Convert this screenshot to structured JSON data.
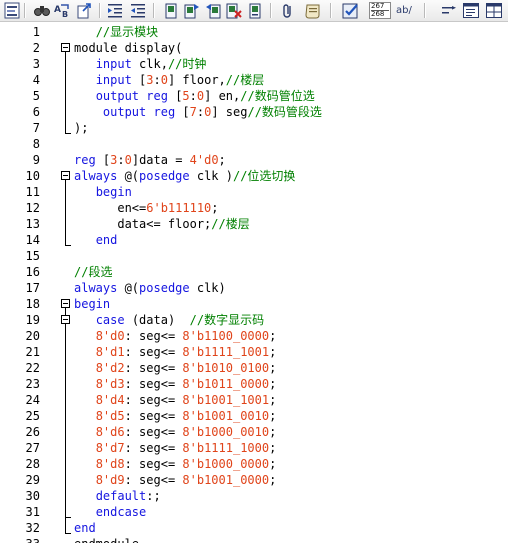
{
  "toolbar": {
    "buttons": [
      {
        "name": "editor-icon"
      },
      {
        "name": "find-icon"
      },
      {
        "name": "replace-icon"
      },
      {
        "name": "goto-icon"
      },
      {
        "name": "indent-icon"
      },
      {
        "name": "outdent-icon"
      },
      {
        "name": "bookmark-toggle-icon"
      },
      {
        "name": "bookmark-next-icon"
      },
      {
        "name": "bookmark-prev-icon"
      },
      {
        "name": "bookmark-clear-icon"
      },
      {
        "name": "bookmark-list-icon"
      },
      {
        "name": "attach-icon"
      },
      {
        "name": "macro-icon"
      },
      {
        "name": "check-icon"
      },
      {
        "name": "number-convert-icon"
      },
      {
        "name": "abbrev-icon"
      },
      {
        "name": "wrap-icon"
      },
      {
        "name": "document-icon"
      },
      {
        "name": "table-icon"
      }
    ],
    "number_icon_top": "267",
    "number_icon_bottom": "268",
    "abbrev_label": "ab/"
  },
  "editor": {
    "lines": [
      {
        "n": "1",
        "tokens": [
          {
            "t": "   ",
            "c": "pun"
          },
          {
            "t": "//显示模块",
            "c": "cmt"
          }
        ]
      },
      {
        "n": "2",
        "tokens": [
          {
            "t": "module display(",
            "c": "pun"
          }
        ]
      },
      {
        "n": "3",
        "tokens": [
          {
            "t": "   ",
            "c": "pun"
          },
          {
            "t": "input",
            "c": "kw"
          },
          {
            "t": " clk,",
            "c": "pun"
          },
          {
            "t": "//时钟",
            "c": "cmt"
          }
        ]
      },
      {
        "n": "4",
        "tokens": [
          {
            "t": "   ",
            "c": "pun"
          },
          {
            "t": "input",
            "c": "kw"
          },
          {
            "t": " [",
            "c": "pun"
          },
          {
            "t": "3",
            "c": "num"
          },
          {
            "t": ":",
            "c": "pun"
          },
          {
            "t": "0",
            "c": "num"
          },
          {
            "t": "] floor,",
            "c": "pun"
          },
          {
            "t": "//楼层",
            "c": "cmt"
          }
        ]
      },
      {
        "n": "5",
        "tokens": [
          {
            "t": "   ",
            "c": "pun"
          },
          {
            "t": "output",
            "c": "kw"
          },
          {
            "t": " ",
            "c": "pun"
          },
          {
            "t": "reg",
            "c": "kw"
          },
          {
            "t": " [",
            "c": "pun"
          },
          {
            "t": "5",
            "c": "num"
          },
          {
            "t": ":",
            "c": "pun"
          },
          {
            "t": "0",
            "c": "num"
          },
          {
            "t": "] en,",
            "c": "pun"
          },
          {
            "t": "//数码管位选",
            "c": "cmt"
          }
        ]
      },
      {
        "n": "6",
        "tokens": [
          {
            "t": "    ",
            "c": "pun"
          },
          {
            "t": "output",
            "c": "kw"
          },
          {
            "t": " ",
            "c": "pun"
          },
          {
            "t": "reg",
            "c": "kw"
          },
          {
            "t": " [",
            "c": "pun"
          },
          {
            "t": "7",
            "c": "num"
          },
          {
            "t": ":",
            "c": "pun"
          },
          {
            "t": "0",
            "c": "num"
          },
          {
            "t": "] seg",
            "c": "pun"
          },
          {
            "t": "//数码管段选",
            "c": "cmt"
          }
        ]
      },
      {
        "n": "7",
        "tokens": [
          {
            "t": ");",
            "c": "pun"
          }
        ]
      },
      {
        "n": "8",
        "tokens": []
      },
      {
        "n": "9",
        "tokens": [
          {
            "t": "reg",
            "c": "kw"
          },
          {
            "t": " [",
            "c": "pun"
          },
          {
            "t": "3",
            "c": "num"
          },
          {
            "t": ":",
            "c": "pun"
          },
          {
            "t": "0",
            "c": "num"
          },
          {
            "t": "]data = ",
            "c": "pun"
          },
          {
            "t": "4'd0",
            "c": "num"
          },
          {
            "t": ";",
            "c": "pun"
          }
        ]
      },
      {
        "n": "10",
        "tokens": [
          {
            "t": "always",
            "c": "kw"
          },
          {
            "t": " @(",
            "c": "pun"
          },
          {
            "t": "posedge",
            "c": "kw"
          },
          {
            "t": " clk )",
            "c": "pun"
          },
          {
            "t": "//位选切换",
            "c": "cmt"
          }
        ]
      },
      {
        "n": "11",
        "tokens": [
          {
            "t": "   ",
            "c": "pun"
          },
          {
            "t": "begin",
            "c": "kw"
          }
        ]
      },
      {
        "n": "12",
        "tokens": [
          {
            "t": "      en<=",
            "c": "pun"
          },
          {
            "t": "6'b111110",
            "c": "num"
          },
          {
            "t": ";",
            "c": "pun"
          }
        ]
      },
      {
        "n": "13",
        "tokens": [
          {
            "t": "      data<= floor;",
            "c": "pun"
          },
          {
            "t": "//楼层",
            "c": "cmt"
          }
        ]
      },
      {
        "n": "14",
        "tokens": [
          {
            "t": "   ",
            "c": "pun"
          },
          {
            "t": "end",
            "c": "kw"
          }
        ]
      },
      {
        "n": "15",
        "tokens": []
      },
      {
        "n": "16",
        "tokens": [
          {
            "t": "//段选",
            "c": "cmt"
          }
        ]
      },
      {
        "n": "17",
        "tokens": [
          {
            "t": "always",
            "c": "kw"
          },
          {
            "t": " @(",
            "c": "pun"
          },
          {
            "t": "posedge",
            "c": "kw"
          },
          {
            "t": " clk)",
            "c": "pun"
          }
        ]
      },
      {
        "n": "18",
        "tokens": [
          {
            "t": "begin",
            "c": "kw"
          }
        ]
      },
      {
        "n": "19",
        "tokens": [
          {
            "t": "   ",
            "c": "pun"
          },
          {
            "t": "case",
            "c": "kw"
          },
          {
            "t": " (data)  ",
            "c": "pun"
          },
          {
            "t": "//数字显示码",
            "c": "cmt"
          }
        ]
      },
      {
        "n": "20",
        "tokens": [
          {
            "t": "   ",
            "c": "pun"
          },
          {
            "t": "8'd0",
            "c": "num"
          },
          {
            "t": ": seg<= ",
            "c": "pun"
          },
          {
            "t": "8'b1100_0000",
            "c": "num"
          },
          {
            "t": ";",
            "c": "pun"
          }
        ]
      },
      {
        "n": "21",
        "tokens": [
          {
            "t": "   ",
            "c": "pun"
          },
          {
            "t": "8'd1",
            "c": "num"
          },
          {
            "t": ": seg<= ",
            "c": "pun"
          },
          {
            "t": "8'b1111_1001",
            "c": "num"
          },
          {
            "t": ";",
            "c": "pun"
          }
        ]
      },
      {
        "n": "22",
        "tokens": [
          {
            "t": "   ",
            "c": "pun"
          },
          {
            "t": "8'd2",
            "c": "num"
          },
          {
            "t": ": seg<= ",
            "c": "pun"
          },
          {
            "t": "8'b1010_0100",
            "c": "num"
          },
          {
            "t": ";",
            "c": "pun"
          }
        ]
      },
      {
        "n": "23",
        "tokens": [
          {
            "t": "   ",
            "c": "pun"
          },
          {
            "t": "8'd3",
            "c": "num"
          },
          {
            "t": ": seg<= ",
            "c": "pun"
          },
          {
            "t": "8'b1011_0000",
            "c": "num"
          },
          {
            "t": ";",
            "c": "pun"
          }
        ]
      },
      {
        "n": "24",
        "tokens": [
          {
            "t": "   ",
            "c": "pun"
          },
          {
            "t": "8'd4",
            "c": "num"
          },
          {
            "t": ": seg<= ",
            "c": "pun"
          },
          {
            "t": "8'b1001_1001",
            "c": "num"
          },
          {
            "t": ";",
            "c": "pun"
          }
        ]
      },
      {
        "n": "25",
        "tokens": [
          {
            "t": "   ",
            "c": "pun"
          },
          {
            "t": "8'd5",
            "c": "num"
          },
          {
            "t": ": seg<= ",
            "c": "pun"
          },
          {
            "t": "8'b1001_0010",
            "c": "num"
          },
          {
            "t": ";",
            "c": "pun"
          }
        ]
      },
      {
        "n": "26",
        "tokens": [
          {
            "t": "   ",
            "c": "pun"
          },
          {
            "t": "8'd6",
            "c": "num"
          },
          {
            "t": ": seg<= ",
            "c": "pun"
          },
          {
            "t": "8'b1000_0010",
            "c": "num"
          },
          {
            "t": ";",
            "c": "pun"
          }
        ]
      },
      {
        "n": "27",
        "tokens": [
          {
            "t": "   ",
            "c": "pun"
          },
          {
            "t": "8'd7",
            "c": "num"
          },
          {
            "t": ": seg<= ",
            "c": "pun"
          },
          {
            "t": "8'b1111_1000",
            "c": "num"
          },
          {
            "t": ";",
            "c": "pun"
          }
        ]
      },
      {
        "n": "28",
        "tokens": [
          {
            "t": "   ",
            "c": "pun"
          },
          {
            "t": "8'd8",
            "c": "num"
          },
          {
            "t": ": seg<= ",
            "c": "pun"
          },
          {
            "t": "8'b1000_0000",
            "c": "num"
          },
          {
            "t": ";",
            "c": "pun"
          }
        ]
      },
      {
        "n": "29",
        "tokens": [
          {
            "t": "   ",
            "c": "pun"
          },
          {
            "t": "8'd9",
            "c": "num"
          },
          {
            "t": ": seg<= ",
            "c": "pun"
          },
          {
            "t": "8'b1001_0000",
            "c": "num"
          },
          {
            "t": ";",
            "c": "pun"
          }
        ]
      },
      {
        "n": "30",
        "tokens": [
          {
            "t": "   ",
            "c": "pun"
          },
          {
            "t": "default",
            "c": "kw"
          },
          {
            "t": ":;",
            "c": "pun"
          }
        ]
      },
      {
        "n": "31",
        "tokens": [
          {
            "t": "   ",
            "c": "pun"
          },
          {
            "t": "endcase",
            "c": "kw"
          }
        ]
      },
      {
        "n": "32",
        "tokens": [
          {
            "t": "end",
            "c": "kw"
          }
        ]
      },
      {
        "n": "33",
        "tokens": [
          {
            "t": "endmodule",
            "c": "pun"
          }
        ]
      }
    ]
  },
  "colors": {
    "comment": "#008000",
    "keyword": "#1515e0",
    "number": "#e0441a",
    "text": "#000000"
  }
}
